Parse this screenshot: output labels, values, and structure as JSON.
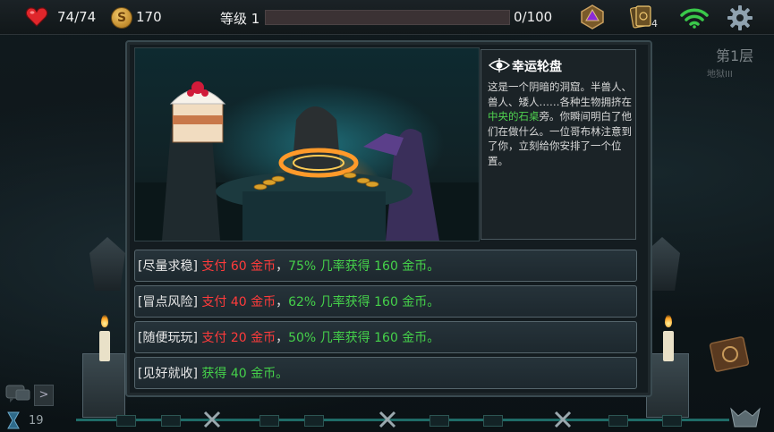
{
  "topbar": {
    "hp": "74/74",
    "gold": "170",
    "coin_symbol": "S",
    "level_label": "等级 1",
    "xp_text": "0/100",
    "xp_progress": 0.0,
    "cards_count": "4"
  },
  "floor": {
    "title": "第1层",
    "subtitle": "地狱III"
  },
  "event": {
    "title": "幸运轮盘",
    "desc_part1": "这是一个阴暗的洞窟。半兽人、兽人、矮人……各种生物拥挤在",
    "desc_highlight": "中央的石桌",
    "desc_part2": "旁。你瞬间明白了他们在做什么。一位哥布林注意到了你，立刻给你安排了一个位置。"
  },
  "options": [
    {
      "tag": "[尽量求稳]",
      "cost": " 支付 60 金币",
      "sep": "，",
      "reward": "75% 几率获得 160 金币。"
    },
    {
      "tag": "[冒点风险]",
      "cost": " 支付 40 金币",
      "sep": "，",
      "reward": "62% 几率获得 160 金币。"
    },
    {
      "tag": "[随便玩玩]",
      "cost": " 支付 20 金币",
      "sep": "，",
      "reward": "50% 几率获得 160 金币。"
    },
    {
      "tag": "[见好就收]",
      "cost": "",
      "sep": "",
      "reward": " 获得 40 金币。"
    }
  ],
  "bottom": {
    "turn_count": "19",
    "arrow": ">"
  },
  "colors": {
    "cost_red": "#ff3b3b",
    "reward_green": "#45d14a",
    "xp_fill": "#8a3b3b",
    "track": "#1f6b67"
  },
  "icons": [
    "heart-icon",
    "coin-icon",
    "die-icon",
    "cards-icon",
    "wifi-icon",
    "gear-icon",
    "eye-icon",
    "chat-icon",
    "hourglass-icon",
    "sword-icon",
    "boss-icon",
    "map-icon"
  ]
}
